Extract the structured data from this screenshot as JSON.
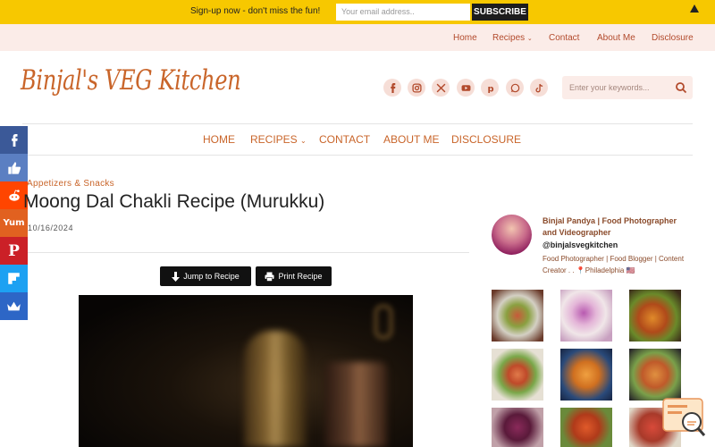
{
  "topbar": {
    "message": "Sign-up now - don't miss the fun!",
    "email_placeholder": "Your email address..",
    "subscribe_label": "SUBSCRIBE"
  },
  "secondary_nav": [
    "Home",
    "Recipes",
    "Contact",
    "About Me",
    "Disclosure"
  ],
  "site": {
    "logo_text": "Binjal's VEG Kitchen",
    "social_icons": [
      "facebook-icon",
      "instagram-icon",
      "x-icon",
      "youtube-icon",
      "pinterest-icon",
      "whatsapp-icon",
      "tiktok-icon"
    ],
    "search_placeholder": "Enter your keywords...",
    "accent_color": "#c9652a"
  },
  "main_nav": [
    "HOME",
    "RECIPES",
    "CONTACT",
    "ABOUT ME",
    "DISCLOSURE"
  ],
  "share_bar": [
    {
      "icon": "facebook-icon",
      "color": "#3b5998"
    },
    {
      "icon": "like-icon",
      "color": "#5b7fc2"
    },
    {
      "icon": "reddit-icon",
      "color": "#ff4500"
    },
    {
      "icon": "yummly-icon",
      "color": "#e16120"
    },
    {
      "icon": "pinterest-icon",
      "color": "#cb2027"
    },
    {
      "icon": "flipboard-icon",
      "color": "#1da1f2"
    },
    {
      "icon": "crown-icon",
      "color": "#2d66c6"
    }
  ],
  "post": {
    "category": "Appetizers & Snacks",
    "title": "Moong Dal Chakli Recipe (Murukku)",
    "date": "10/16/2024",
    "jump_label": "Jump to Recipe",
    "print_label": "Print Recipe"
  },
  "author": {
    "name": "Binjal Pandya | Food Photographer and Videographer",
    "handle": "@binjalsvegkitchen",
    "bio": "Food Photographer | Food Blogger | Content Creator . . 📍Philadelphia 🇺🇸"
  }
}
